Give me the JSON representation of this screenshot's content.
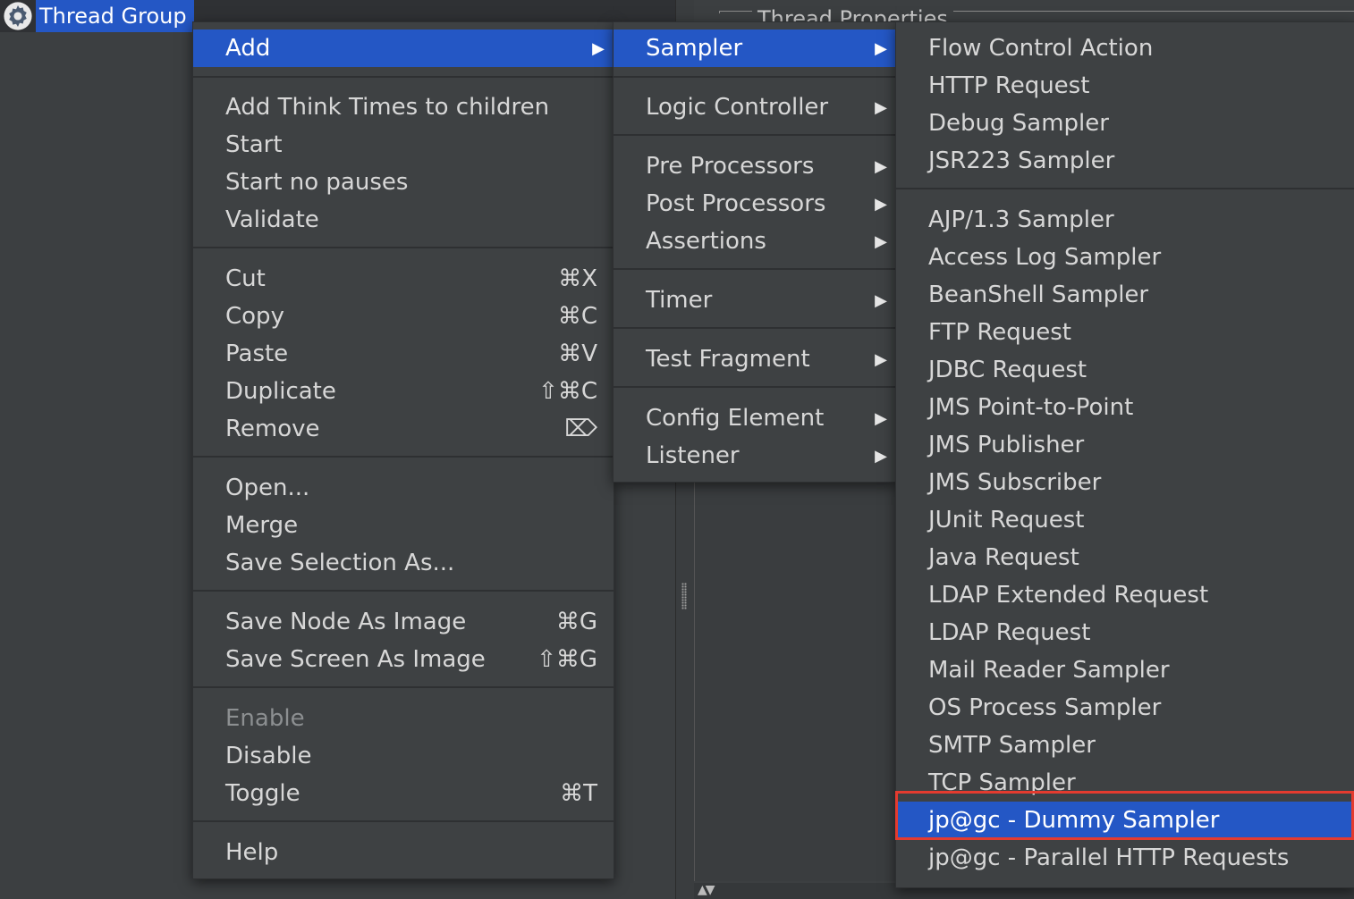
{
  "tree": {
    "node_label": "Thread Group",
    "node_icon": "gear-icon"
  },
  "right_pane": {
    "section_title": "Thread Properties"
  },
  "main_menu": {
    "items": [
      {
        "label": "Add",
        "arrow": "▶"
      },
      {
        "label": "Add Think Times to children"
      },
      {
        "label": "Start"
      },
      {
        "label": "Start no pauses"
      },
      {
        "label": "Validate"
      },
      {
        "label": "Cut",
        "shortcut": "⌘X"
      },
      {
        "label": "Copy",
        "shortcut": "⌘C"
      },
      {
        "label": "Paste",
        "shortcut": "⌘V"
      },
      {
        "label": "Duplicate",
        "shortcut": "⇧⌘C"
      },
      {
        "label": "Remove",
        "shortcut": "⌦"
      },
      {
        "label": "Open..."
      },
      {
        "label": "Merge"
      },
      {
        "label": "Save Selection As..."
      },
      {
        "label": "Save Node As Image",
        "shortcut": "⌘G"
      },
      {
        "label": "Save Screen As Image",
        "shortcut": "⇧⌘G"
      },
      {
        "label": "Enable"
      },
      {
        "label": "Disable"
      },
      {
        "label": "Toggle",
        "shortcut": "⌘T"
      },
      {
        "label": "Help"
      }
    ]
  },
  "add_menu": {
    "items": [
      {
        "label": "Sampler",
        "arrow": "▶"
      },
      {
        "label": "Logic Controller",
        "arrow": "▶"
      },
      {
        "label": "Pre Processors",
        "arrow": "▶"
      },
      {
        "label": "Post Processors",
        "arrow": "▶"
      },
      {
        "label": "Assertions",
        "arrow": "▶"
      },
      {
        "label": "Timer",
        "arrow": "▶"
      },
      {
        "label": "Test Fragment",
        "arrow": "▶"
      },
      {
        "label": "Config Element",
        "arrow": "▶"
      },
      {
        "label": "Listener",
        "arrow": "▶"
      }
    ]
  },
  "sampler_menu": {
    "items": [
      "Flow Control Action",
      "HTTP Request",
      "Debug Sampler",
      "JSR223 Sampler",
      "AJP/1.3 Sampler",
      "Access Log Sampler",
      "BeanShell Sampler",
      "FTP Request",
      "JDBC Request",
      "JMS Point-to-Point",
      "JMS Publisher",
      "JMS Subscriber",
      "JUnit Request",
      "Java Request",
      "LDAP Extended Request",
      "LDAP Request",
      "Mail Reader Sampler",
      "OS Process Sampler",
      "SMTP Sampler",
      "TCP Sampler",
      "jp@gc - Dummy Sampler",
      "jp@gc - Parallel HTTP Requests"
    ]
  },
  "colors": {
    "highlight": "#2457c5",
    "annotation": "#e43b2f",
    "menu_bg": "#3e4143"
  }
}
